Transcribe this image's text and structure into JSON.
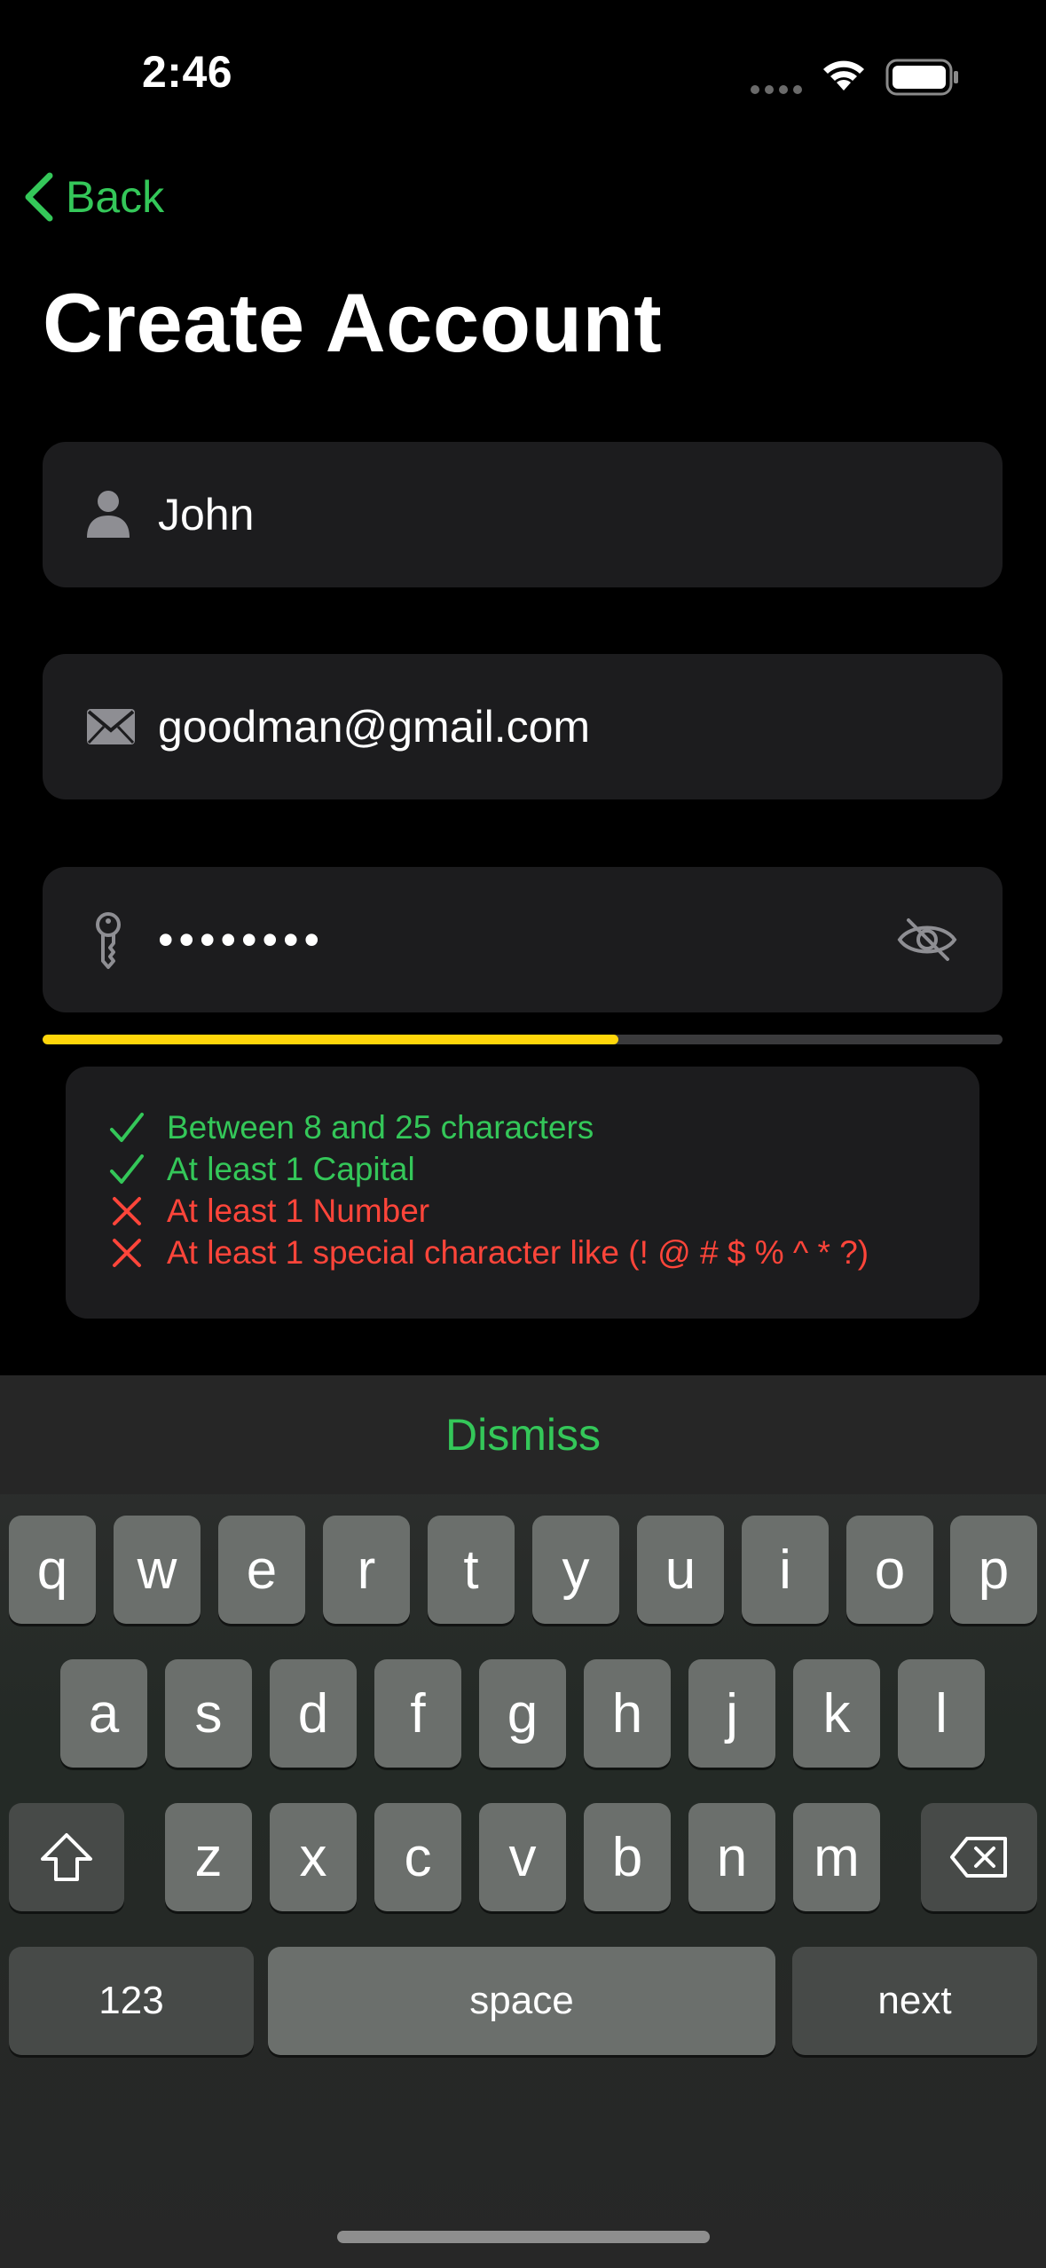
{
  "status_bar": {
    "time": "2:46"
  },
  "nav": {
    "back_label": "Back"
  },
  "title": "Create Account",
  "fields": {
    "name": {
      "value": "John",
      "icon": "person-icon"
    },
    "email": {
      "value": "goodman@gmail.com",
      "icon": "envelope-icon"
    },
    "password": {
      "value": "••••••••",
      "icon": "key-icon",
      "toggle_icon": "eye-slash-icon"
    }
  },
  "password_strength": {
    "fraction": 0.6,
    "color": "#ffd60a"
  },
  "requirements": [
    {
      "text": "Between 8 and 25 characters",
      "met": true
    },
    {
      "text": "At least 1 Capital",
      "met": true
    },
    {
      "text": "At least 1 Number",
      "met": false
    },
    {
      "text": "At least 1 special character like (! @ # $ % ^ * ?)",
      "met": false
    }
  ],
  "colors": {
    "accent": "#34c759",
    "error": "#ff453a",
    "strength": "#ffd60a"
  },
  "keyboard": {
    "toolbar_label": "Dismiss",
    "row1": [
      "q",
      "w",
      "e",
      "r",
      "t",
      "y",
      "u",
      "i",
      "o",
      "p"
    ],
    "row2": [
      "a",
      "s",
      "d",
      "f",
      "g",
      "h",
      "j",
      "k",
      "l"
    ],
    "row3": [
      "z",
      "x",
      "c",
      "v",
      "b",
      "n",
      "m"
    ],
    "numbers_label": "123",
    "space_label": "space",
    "return_label": "next"
  }
}
